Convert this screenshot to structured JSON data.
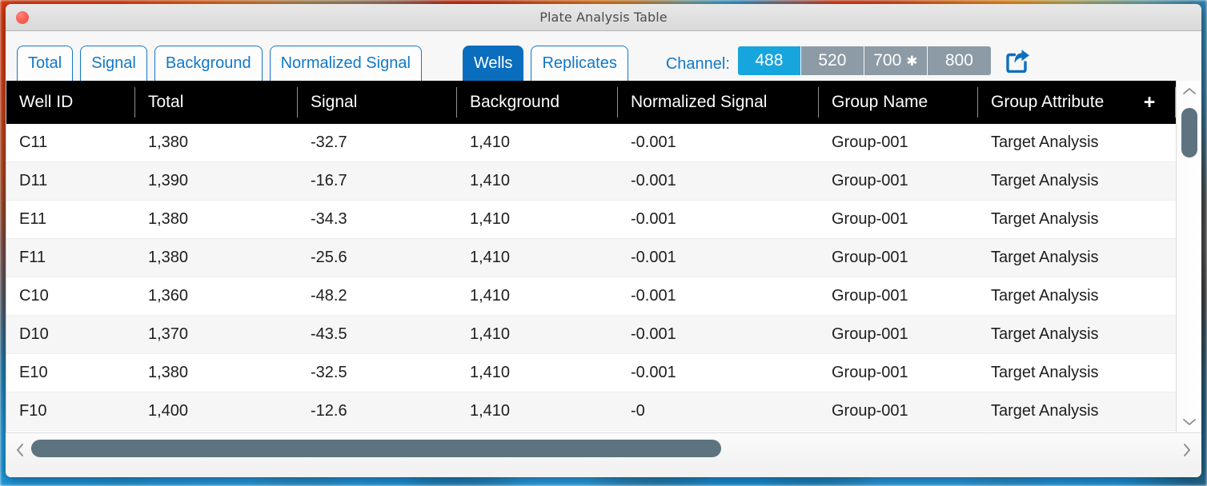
{
  "window": {
    "title": "Plate Analysis Table",
    "close_button": "close"
  },
  "toolbar": {
    "metric_tabs": [
      {
        "label": "Total",
        "active": false
      },
      {
        "label": "Signal",
        "active": false
      },
      {
        "label": "Background",
        "active": false
      },
      {
        "label": "Normalized Signal",
        "active": false
      }
    ],
    "view_tabs": [
      {
        "label": "Wells",
        "active": true
      },
      {
        "label": "Replicates",
        "active": false
      }
    ],
    "channel_label": "Channel:",
    "channels": [
      {
        "label": "488",
        "active": true,
        "marked": false
      },
      {
        "label": "520",
        "active": false,
        "marked": false
      },
      {
        "label": "700",
        "active": false,
        "marked": true
      },
      {
        "label": "800",
        "active": false,
        "marked": false
      }
    ],
    "channel_marker": "✱",
    "export_icon": "export-share-icon",
    "accent_blue": "#1278c8",
    "active_tab_blue": "#0a6dbd",
    "active_channel_blue": "#17a5dd",
    "inactive_channel_gray": "#8c9ba5"
  },
  "table": {
    "add_column_label": "✛",
    "columns": [
      "Well ID",
      "Total",
      "Signal",
      "Background",
      "Normalized Signal",
      "Group Name",
      "Group Attribute"
    ],
    "rows": [
      {
        "well_id": "C11",
        "total": "1,380",
        "signal": "-32.7",
        "background": "1,410",
        "normalized_signal": "-0.001",
        "group_name": "Group-001",
        "group_attribute": "Target Analysis"
      },
      {
        "well_id": "D11",
        "total": "1,390",
        "signal": "-16.7",
        "background": "1,410",
        "normalized_signal": "-0.001",
        "group_name": "Group-001",
        "group_attribute": "Target Analysis"
      },
      {
        "well_id": "E11",
        "total": "1,380",
        "signal": "-34.3",
        "background": "1,410",
        "normalized_signal": "-0.001",
        "group_name": "Group-001",
        "group_attribute": "Target Analysis"
      },
      {
        "well_id": "F11",
        "total": "1,380",
        "signal": "-25.6",
        "background": "1,410",
        "normalized_signal": "-0.001",
        "group_name": "Group-001",
        "group_attribute": "Target Analysis"
      },
      {
        "well_id": "C10",
        "total": "1,360",
        "signal": "-48.2",
        "background": "1,410",
        "normalized_signal": "-0.001",
        "group_name": "Group-001",
        "group_attribute": "Target Analysis"
      },
      {
        "well_id": "D10",
        "total": "1,370",
        "signal": "-43.5",
        "background": "1,410",
        "normalized_signal": "-0.001",
        "group_name": "Group-001",
        "group_attribute": "Target Analysis"
      },
      {
        "well_id": "E10",
        "total": "1,380",
        "signal": "-32.5",
        "background": "1,410",
        "normalized_signal": "-0.001",
        "group_name": "Group-001",
        "group_attribute": "Target Analysis"
      },
      {
        "well_id": "F10",
        "total": "1,400",
        "signal": "-12.6",
        "background": "1,410",
        "normalized_signal": "-0",
        "group_name": "Group-001",
        "group_attribute": "Target Analysis"
      }
    ]
  },
  "scrollbars": {
    "vertical": {
      "up_arrow": "⌃",
      "down_arrow": "⌄",
      "thumb_color": "#5d7480"
    },
    "horizontal": {
      "left_arrow": "‹",
      "right_arrow": "›",
      "thumb_color": "#5d7480"
    }
  }
}
